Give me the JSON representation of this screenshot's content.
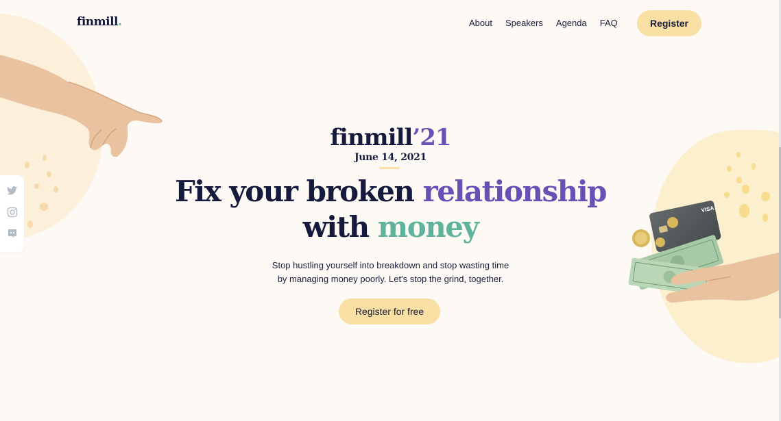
{
  "nav": {
    "logo": "finmill",
    "logo_dot": ".",
    "links": [
      "About",
      "Speakers",
      "Agenda",
      "FAQ"
    ],
    "register_label": "Register"
  },
  "social": {
    "icons": [
      "twitter-icon",
      "instagram-icon",
      "discord-icon"
    ]
  },
  "hero": {
    "brand": "finmill",
    "year": "’21",
    "date": "June 14, 2021",
    "headline_part1": "Fix your broken ",
    "headline_highlight1": "relationship",
    "headline_part2": "with ",
    "headline_highlight2": "money",
    "subtext_line1": "Stop hustling yourself into breakdown and stop wasting time",
    "subtext_line2": "by managing money poorly. Let's stop the grind, together.",
    "cta_label": "Register for free",
    "card_brand": "VISA"
  },
  "colors": {
    "background": "#fdf9f4",
    "accent_yellow": "#f8dfa4",
    "purple": "#6452b4",
    "green": "#5fb39a",
    "navy": "#161a3d"
  }
}
